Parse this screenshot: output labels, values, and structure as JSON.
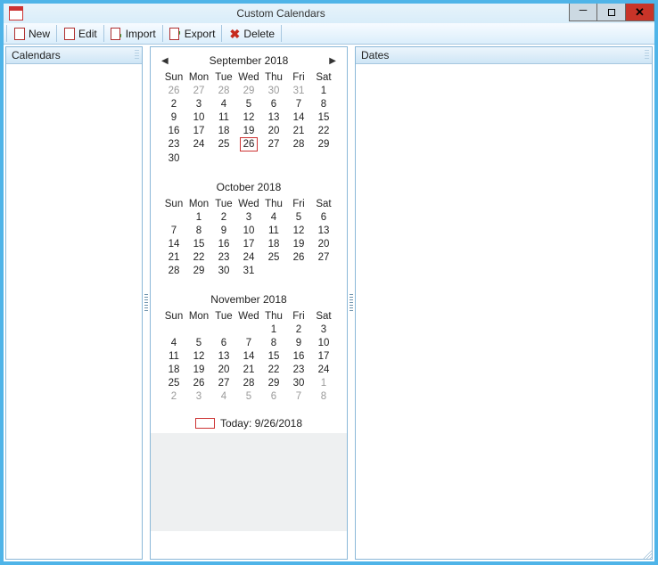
{
  "window": {
    "title": "Custom Calendars"
  },
  "toolbar": {
    "new": "New",
    "edit": "Edit",
    "import": "Import",
    "export": "Export",
    "delete": "Delete"
  },
  "panels": {
    "left_title": "Calendars",
    "right_title": "Dates"
  },
  "dow": [
    "Sun",
    "Mon",
    "Tue",
    "Wed",
    "Thu",
    "Fri",
    "Sat"
  ],
  "today_label": "Today: 9/26/2018",
  "months": [
    {
      "title": "September 2018",
      "nav": true,
      "weeks": [
        [
          {
            "d": 26,
            "pad": true
          },
          {
            "d": 27,
            "pad": true
          },
          {
            "d": 28,
            "pad": true
          },
          {
            "d": 29,
            "pad": true
          },
          {
            "d": 30,
            "pad": true
          },
          {
            "d": 31,
            "pad": true
          },
          {
            "d": 1
          }
        ],
        [
          {
            "d": 2
          },
          {
            "d": 3
          },
          {
            "d": 4
          },
          {
            "d": 5
          },
          {
            "d": 6
          },
          {
            "d": 7
          },
          {
            "d": 8
          }
        ],
        [
          {
            "d": 9
          },
          {
            "d": 10
          },
          {
            "d": 11
          },
          {
            "d": 12
          },
          {
            "d": 13
          },
          {
            "d": 14
          },
          {
            "d": 15
          }
        ],
        [
          {
            "d": 16
          },
          {
            "d": 17
          },
          {
            "d": 18
          },
          {
            "d": 19
          },
          {
            "d": 20
          },
          {
            "d": 21
          },
          {
            "d": 22
          }
        ],
        [
          {
            "d": 23
          },
          {
            "d": 24
          },
          {
            "d": 25
          },
          {
            "d": 26,
            "today": true
          },
          {
            "d": 27
          },
          {
            "d": 28
          },
          {
            "d": 29
          }
        ],
        [
          {
            "d": 30
          },
          {
            "d": ""
          },
          {
            "d": ""
          },
          {
            "d": ""
          },
          {
            "d": ""
          },
          {
            "d": ""
          },
          {
            "d": ""
          }
        ]
      ]
    },
    {
      "title": "October 2018",
      "nav": false,
      "weeks": [
        [
          {
            "d": ""
          },
          {
            "d": 1
          },
          {
            "d": 2
          },
          {
            "d": 3
          },
          {
            "d": 4
          },
          {
            "d": 5
          },
          {
            "d": 6
          }
        ],
        [
          {
            "d": 7
          },
          {
            "d": 8
          },
          {
            "d": 9
          },
          {
            "d": 10
          },
          {
            "d": 11
          },
          {
            "d": 12
          },
          {
            "d": 13
          }
        ],
        [
          {
            "d": 14
          },
          {
            "d": 15
          },
          {
            "d": 16
          },
          {
            "d": 17
          },
          {
            "d": 18
          },
          {
            "d": 19
          },
          {
            "d": 20
          }
        ],
        [
          {
            "d": 21
          },
          {
            "d": 22
          },
          {
            "d": 23
          },
          {
            "d": 24
          },
          {
            "d": 25
          },
          {
            "d": 26
          },
          {
            "d": 27
          }
        ],
        [
          {
            "d": 28
          },
          {
            "d": 29
          },
          {
            "d": 30
          },
          {
            "d": 31
          },
          {
            "d": ""
          },
          {
            "d": ""
          },
          {
            "d": ""
          }
        ]
      ]
    },
    {
      "title": "November 2018",
      "nav": false,
      "weeks": [
        [
          {
            "d": ""
          },
          {
            "d": ""
          },
          {
            "d": ""
          },
          {
            "d": ""
          },
          {
            "d": 1
          },
          {
            "d": 2
          },
          {
            "d": 3
          }
        ],
        [
          {
            "d": 4
          },
          {
            "d": 5
          },
          {
            "d": 6
          },
          {
            "d": 7
          },
          {
            "d": 8
          },
          {
            "d": 9
          },
          {
            "d": 10
          }
        ],
        [
          {
            "d": 11
          },
          {
            "d": 12
          },
          {
            "d": 13
          },
          {
            "d": 14
          },
          {
            "d": 15
          },
          {
            "d": 16
          },
          {
            "d": 17
          }
        ],
        [
          {
            "d": 18
          },
          {
            "d": 19
          },
          {
            "d": 20
          },
          {
            "d": 21
          },
          {
            "d": 22
          },
          {
            "d": 23
          },
          {
            "d": 24
          }
        ],
        [
          {
            "d": 25
          },
          {
            "d": 26
          },
          {
            "d": 27
          },
          {
            "d": 28
          },
          {
            "d": 29
          },
          {
            "d": 30
          },
          {
            "d": 1,
            "pad": true
          }
        ],
        [
          {
            "d": 2,
            "pad": true
          },
          {
            "d": 3,
            "pad": true
          },
          {
            "d": 4,
            "pad": true
          },
          {
            "d": 5,
            "pad": true
          },
          {
            "d": 6,
            "pad": true
          },
          {
            "d": 7,
            "pad": true
          },
          {
            "d": 8,
            "pad": true
          }
        ]
      ]
    }
  ]
}
